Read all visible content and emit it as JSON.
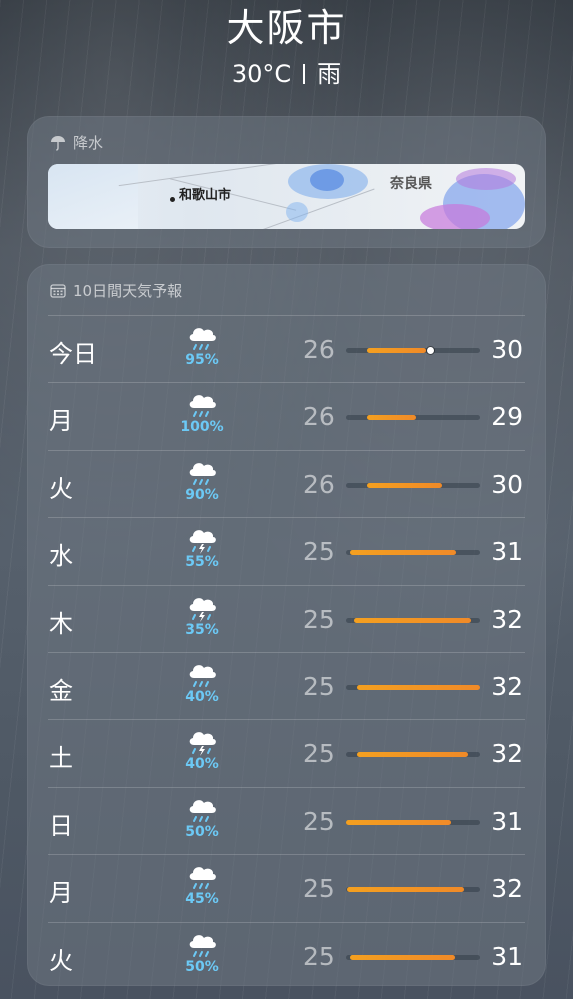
{
  "header": {
    "city": "大阪市",
    "temperature": "30°C",
    "condition": "雨"
  },
  "precip": {
    "title": "降水",
    "map_labels": {
      "city": "和歌山市",
      "region": "奈良県"
    }
  },
  "forecast": {
    "title": "10日間天気予報",
    "days": [
      {
        "day": "今日",
        "icon": "cloud-rain-icon",
        "pct": "95%",
        "lo": "26",
        "hi": "30",
        "fill": [
          0.16,
          0.6
        ],
        "now": 0.63
      },
      {
        "day": "月",
        "icon": "cloud-rain-icon",
        "pct": "100%",
        "lo": "26",
        "hi": "29",
        "fill": [
          0.16,
          0.52
        ]
      },
      {
        "day": "火",
        "icon": "cloud-rain-icon",
        "pct": "90%",
        "lo": "26",
        "hi": "30",
        "fill": [
          0.16,
          0.72
        ]
      },
      {
        "day": "水",
        "icon": "cloud-bolt-rain-icon",
        "pct": "55%",
        "lo": "25",
        "hi": "31",
        "fill": [
          0.03,
          0.82
        ]
      },
      {
        "day": "木",
        "icon": "cloud-bolt-rain-icon",
        "pct": "35%",
        "lo": "25",
        "hi": "32",
        "fill": [
          0.06,
          0.93
        ]
      },
      {
        "day": "金",
        "icon": "cloud-rain-icon",
        "pct": "40%",
        "lo": "25",
        "hi": "32",
        "fill": [
          0.08,
          1.0
        ]
      },
      {
        "day": "土",
        "icon": "cloud-bolt-rain-icon",
        "pct": "40%",
        "lo": "25",
        "hi": "32",
        "fill": [
          0.08,
          0.91
        ]
      },
      {
        "day": "日",
        "icon": "cloud-rain-icon",
        "pct": "50%",
        "lo": "25",
        "hi": "31",
        "fill": [
          0.0,
          0.78
        ]
      },
      {
        "day": "月",
        "icon": "cloud-rain-icon",
        "pct": "45%",
        "lo": "25",
        "hi": "32",
        "fill": [
          0.01,
          0.88
        ]
      },
      {
        "day": "火",
        "icon": "cloud-rain-icon",
        "pct": "50%",
        "lo": "25",
        "hi": "31",
        "fill": [
          0.03,
          0.81
        ]
      }
    ]
  }
}
